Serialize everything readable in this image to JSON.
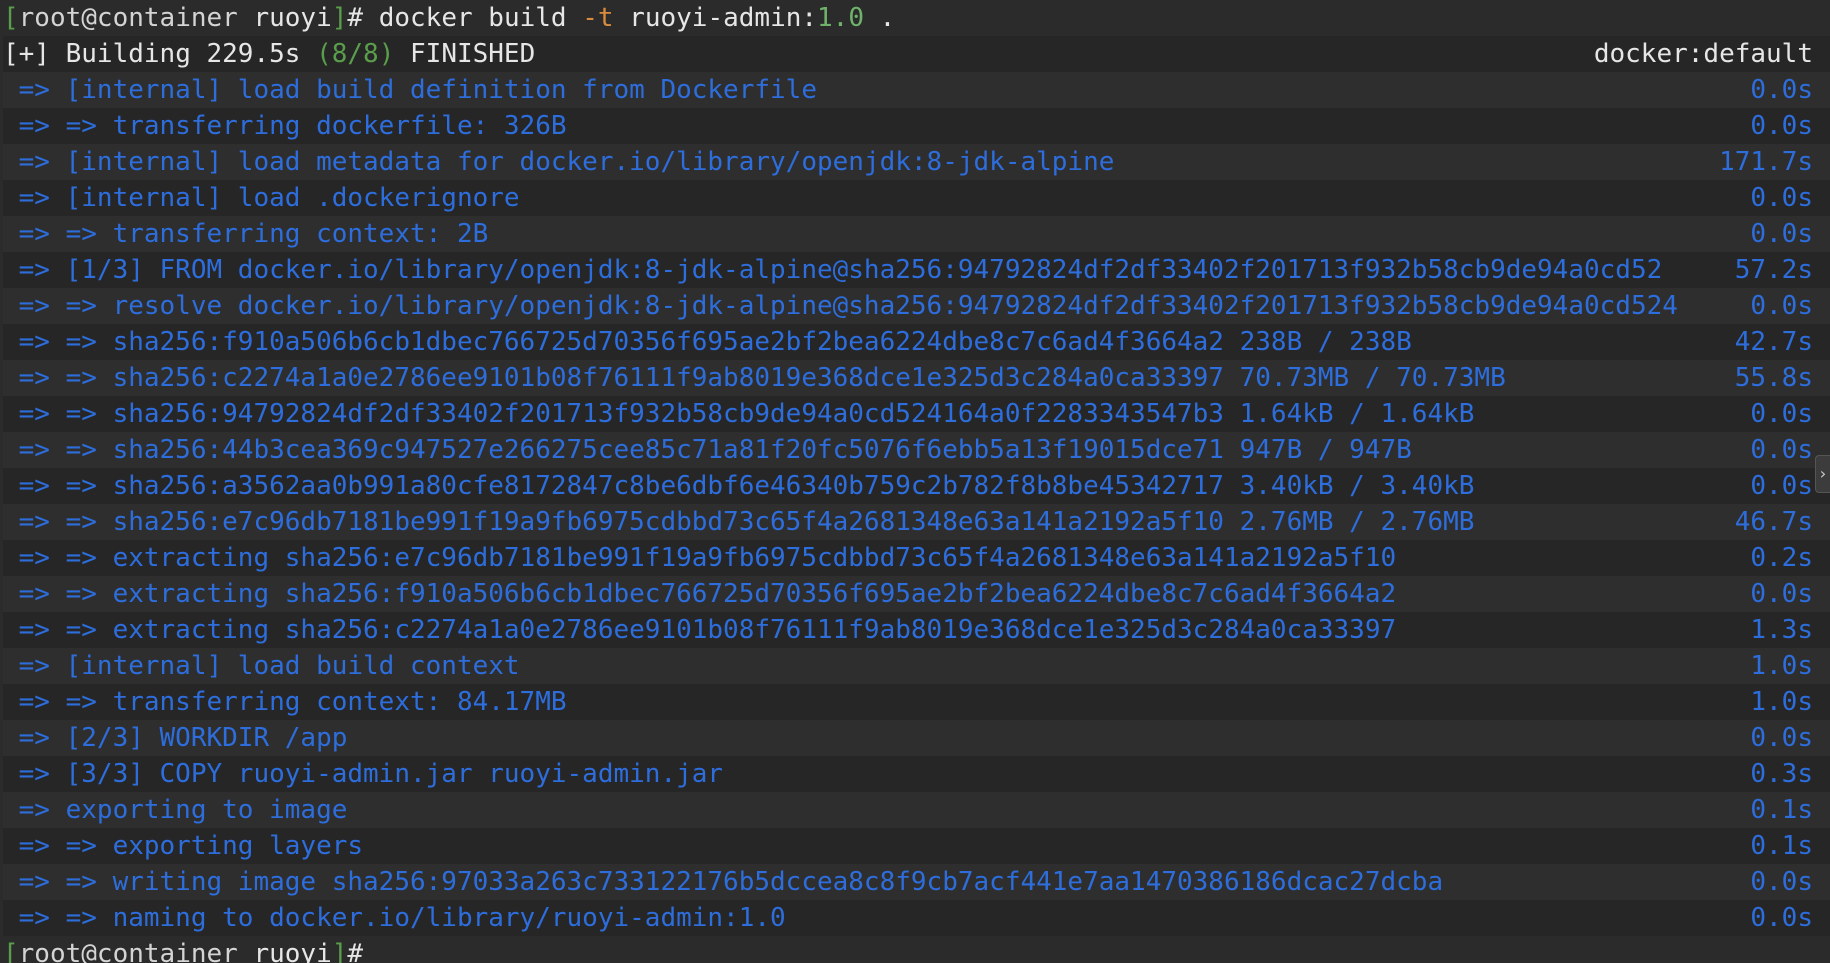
{
  "prompt": {
    "open": "[",
    "user_host": "root@container",
    "dir": "ruoyi",
    "close": "]",
    "symbol": "#"
  },
  "command": {
    "cmd": "docker build",
    "flag": "-t",
    "image": "ruoyi-admin:",
    "version": "1.0",
    "context": "."
  },
  "header": {
    "left_prefix": "[+]",
    "left_text": " Building 229.5s ",
    "count": "(8/8)",
    "status": " FINISHED",
    "right": "docker:default"
  },
  "steps": [
    {
      "text": "=> [internal] load build definition from Dockerfile",
      "time": "0.0s"
    },
    {
      "text": "=> => transferring dockerfile: 326B",
      "time": "0.0s"
    },
    {
      "text": "=> [internal] load metadata for docker.io/library/openjdk:8-jdk-alpine",
      "time": "171.7s"
    },
    {
      "text": "=> [internal] load .dockerignore",
      "time": "0.0s"
    },
    {
      "text": "=> => transferring context: 2B",
      "time": "0.0s"
    },
    {
      "text": "=> [1/3] FROM docker.io/library/openjdk:8-jdk-alpine@sha256:94792824df2df33402f201713f932b58cb9de94a0cd52",
      "time": "57.2s"
    },
    {
      "text": "=> => resolve docker.io/library/openjdk:8-jdk-alpine@sha256:94792824df2df33402f201713f932b58cb9de94a0cd524",
      "time": "0.0s"
    },
    {
      "text": "=> => sha256:f910a506b6cb1dbec766725d70356f695ae2bf2bea6224dbe8c7c6ad4f3664a2 238B / 238B",
      "time": "42.7s"
    },
    {
      "text": "=> => sha256:c2274a1a0e2786ee9101b08f76111f9ab8019e368dce1e325d3c284a0ca33397 70.73MB / 70.73MB",
      "time": "55.8s"
    },
    {
      "text": "=> => sha256:94792824df2df33402f201713f932b58cb9de94a0cd524164a0f2283343547b3 1.64kB / 1.64kB",
      "time": "0.0s"
    },
    {
      "text": "=> => sha256:44b3cea369c947527e266275cee85c71a81f20fc5076f6ebb5a13f19015dce71 947B / 947B",
      "time": "0.0s"
    },
    {
      "text": "=> => sha256:a3562aa0b991a80cfe8172847c8be6dbf6e46340b759c2b782f8b8be45342717 3.40kB / 3.40kB",
      "time": "0.0s"
    },
    {
      "text": "=> => sha256:e7c96db7181be991f19a9fb6975cdbbd73c65f4a2681348e63a141a2192a5f10 2.76MB / 2.76MB",
      "time": "46.7s"
    },
    {
      "text": "=> => extracting sha256:e7c96db7181be991f19a9fb6975cdbbd73c65f4a2681348e63a141a2192a5f10",
      "time": "0.2s"
    },
    {
      "text": "=> => extracting sha256:f910a506b6cb1dbec766725d70356f695ae2bf2bea6224dbe8c7c6ad4f3664a2",
      "time": "0.0s"
    },
    {
      "text": "=> => extracting sha256:c2274a1a0e2786ee9101b08f76111f9ab8019e368dce1e325d3c284a0ca33397",
      "time": "1.3s"
    },
    {
      "text": "=> [internal] load build context",
      "time": "1.0s"
    },
    {
      "text": "=> => transferring context: 84.17MB",
      "time": "1.0s"
    },
    {
      "text": "=> [2/3] WORKDIR /app",
      "time": "0.0s"
    },
    {
      "text": "=> [3/3] COPY ruoyi-admin.jar ruoyi-admin.jar",
      "time": "0.3s"
    },
    {
      "text": "=> exporting to image",
      "time": "0.1s"
    },
    {
      "text": "=> => exporting layers",
      "time": "0.1s"
    },
    {
      "text": "=> => writing image sha256:97033a263c733122176b5dccea8c8f9cb7acf441e7aa1470386186dcac27dcba",
      "time": "0.0s"
    },
    {
      "text": "=> => naming to docker.io/library/ruoyi-admin:1.0",
      "time": "0.0s"
    }
  ],
  "scroll_handle_glyph": "›",
  "colors": {
    "background": "#2b2b2b",
    "step_text": "#2d6ddc",
    "prompt_bracket": "#5a9e4b",
    "flag": "#d98a3d",
    "version": "#6fb36b"
  }
}
